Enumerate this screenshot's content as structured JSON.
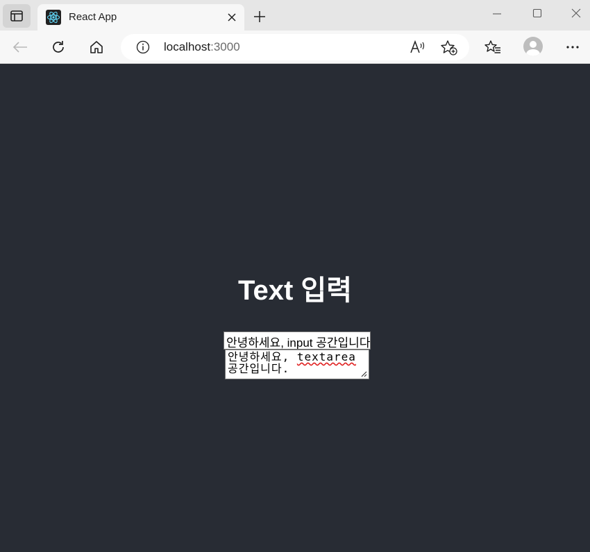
{
  "browser": {
    "tab": {
      "title": "React App"
    },
    "address": {
      "host": "localhost",
      "port": ":3000"
    }
  },
  "page": {
    "heading": "Text 입력",
    "input_value": "안녕하세요, input 공간입니다.",
    "textarea": {
      "line1_prefix": "안녕하세요, ",
      "line1_word": "textarea",
      "line2": "공간입니다."
    }
  },
  "colors": {
    "page_background": "#282c34",
    "heading": "#ffffff",
    "react_logo": "#61dafb"
  }
}
